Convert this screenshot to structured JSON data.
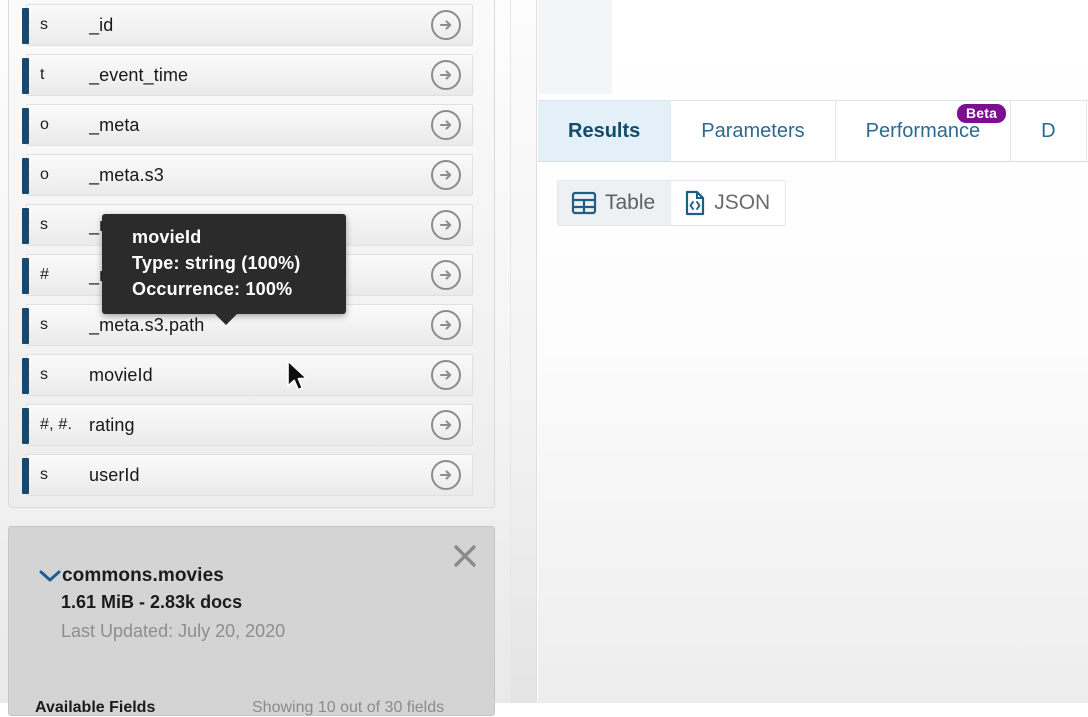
{
  "fields_panel": {
    "rows": [
      {
        "type": "s",
        "name": "_id",
        "action_icon": "arrow-right-circle-icon"
      },
      {
        "type": "t",
        "name": "_event_time",
        "action_icon": "arrow-right-circle-icon"
      },
      {
        "type": "o",
        "name": "_meta",
        "action_icon": "arrow-right-circle-icon"
      },
      {
        "type": "o",
        "name": "_meta.s3",
        "action_icon": "arrow-right-circle-icon"
      },
      {
        "type": "s",
        "name": "_meta.s3.bucket",
        "action_icon": "arrow-right-circle-icon"
      },
      {
        "type": "#",
        "name": "_meta.s3.size",
        "action_icon": "arrow-right-circle-icon"
      },
      {
        "type": "s",
        "name": "_meta.s3.path",
        "action_icon": "arrow-right-circle-icon"
      },
      {
        "type": "s",
        "name": "movieId",
        "action_icon": "arrow-right-circle-icon"
      },
      {
        "type": "#, #.",
        "name": "rating",
        "action_icon": "arrow-right-circle-icon"
      },
      {
        "type": "s",
        "name": "userId",
        "action_icon": "arrow-right-circle-icon"
      }
    ]
  },
  "tooltip": {
    "field_name": "movieId",
    "type_line": "Type: string (100%)",
    "occurrence_line": "Occurrence: 100%"
  },
  "collection_info": {
    "close_icon": "close-icon",
    "expand_icon": "chevron-down-icon",
    "name": "commons.movies",
    "size": "1.61 MiB - 2.83k docs",
    "last_updated": "Last Updated: July 20, 2020",
    "available_fields_label": "Available Fields",
    "showing_count": "Showing 10 out of 30 fields"
  },
  "results_pane": {
    "tabs": [
      {
        "label": "Results",
        "active": true,
        "badge": null
      },
      {
        "label": "Parameters",
        "active": false,
        "badge": null
      },
      {
        "label": "Performance",
        "active": false,
        "badge": "Beta"
      },
      {
        "label": "D",
        "active": false,
        "badge": null
      }
    ],
    "view_toggle": [
      {
        "label": "Table",
        "icon": "table-grid-icon",
        "active": true
      },
      {
        "label": "JSON",
        "icon": "json-file-icon",
        "active": false
      }
    ]
  },
  "colors": {
    "field_marker": "#17496f",
    "tooltip_bg": "#2b2b2b",
    "tab_active_bg": "#e4f0f8",
    "tab_text": "#2b6a93",
    "beta_badge": "#7b0f8f",
    "chevron": "#1e5e94"
  }
}
